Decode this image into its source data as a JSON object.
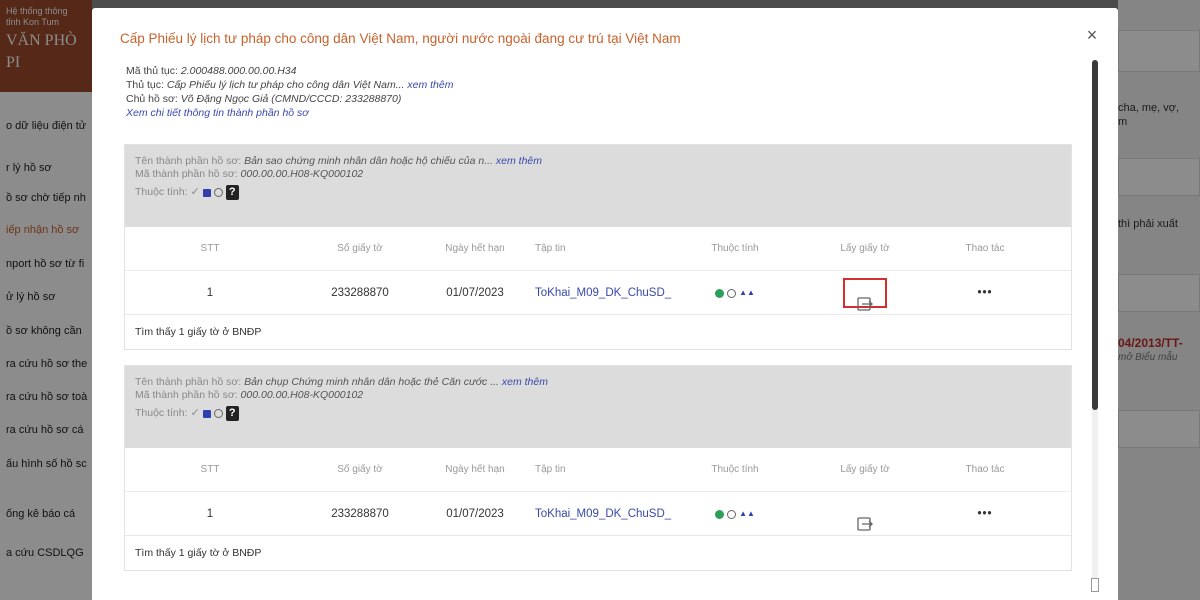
{
  "background": {
    "sidebar": {
      "brand_line1": "Hệ thống thông",
      "brand_line2": "tỉnh Kon Tum",
      "brand_line3": "VĂN PHÒ",
      "brand_line4": "PI",
      "items": [
        {
          "label": "o dữ liệu điện tử",
          "active": false
        },
        {
          "label": "r lý hồ sơ",
          "active": false
        },
        {
          "label": "ồ sơ chờ tiếp nh",
          "active": false
        },
        {
          "label": "iếp nhận hồ sơ",
          "active": true
        },
        {
          "label": "nport hồ sơ từ fi",
          "active": false
        },
        {
          "label": "ử lý hồ sơ",
          "active": false
        },
        {
          "label": "ồ sơ không cần",
          "active": false
        },
        {
          "label": "ra cứu hồ sơ the",
          "active": false
        },
        {
          "label": "ra cứu hồ sơ toà",
          "active": false
        },
        {
          "label": "ra cứu hồ sơ cá",
          "active": false
        },
        {
          "label": "ấu hình số hồ sc",
          "active": false
        },
        {
          "label": "ống kê báo cá",
          "active": false
        },
        {
          "label": "a cứu CSDLQG",
          "active": false
        }
      ]
    },
    "right": {
      "text1": "cha, mẹ, vợ,",
      "text2": "m",
      "text3": "thì phải xuất",
      "red_text": "04/2013/TT-",
      "italic_text": "mở Biểu mẫu"
    }
  },
  "modal": {
    "title": "Cấp Phiếu lý lịch tư pháp cho công dân Việt Nam, người nước ngoài đang cư trú tại Việt Nam",
    "close_symbol": "×",
    "info": {
      "ma_thu_tuc_label": "Mã thủ tục:",
      "ma_thu_tuc_value": "2.000488.000.00.00.H34",
      "thu_tuc_label": "Thủ tục:",
      "thu_tuc_value": "Cấp Phiếu lý lịch tư pháp cho công dân Việt Nam...",
      "xem_them": "xem thêm",
      "chu_ho_so_label": "Chủ hồ sơ:",
      "chu_ho_so_value": "Võ Đặng Ngọc Giả (CMND/CCCD: 233288870)",
      "detail_link": "Xem chi tiết thông tin thành phần hồ sơ"
    },
    "columns": {
      "stt": "STT",
      "so_giay_to": "Số giấy tờ",
      "ngay_het_han": "Ngày hết hạn",
      "tap_tin": "Tập tin",
      "thuoc_tinh": "Thuộc tính",
      "lay_giay_to": "Lấy giấy tờ",
      "thao_tac": "Thao tác"
    },
    "components": [
      {
        "ten_label": "Tên thành phần hồ sơ:",
        "ten_value": "Bản sao chứng minh nhân dân hoặc hộ chiếu của n...",
        "xem_them": "xem thêm",
        "ma_label": "Mã thành phần hồ sơ:",
        "ma_value": "000.00.00.H08-KQ000102",
        "thuoc_tinh_label": "Thuộc tính:",
        "row": {
          "stt": "1",
          "so_giay_to": "233288870",
          "ngay_het_han": "01/07/2023",
          "tap_tin": "ToKhai_M09_DK_ChuSD_",
          "actions": "•••"
        },
        "found_text": "Tìm thấy 1 giấy tờ ở BNĐP",
        "highlighted": true
      },
      {
        "ten_label": "Tên thành phần hồ sơ:",
        "ten_value": "Bản chụp Chứng minh nhân dân hoặc thẻ Căn cước ...",
        "xem_them": "xem thêm",
        "ma_label": "Mã thành phần hồ sơ:",
        "ma_value": "000.00.00.H08-KQ000102",
        "thuoc_tinh_label": "Thuộc tính:",
        "row": {
          "stt": "1",
          "so_giay_to": "233288870",
          "ngay_het_han": "01/07/2023",
          "tap_tin": "ToKhai_M09_DK_ChuSD_",
          "actions": "•••"
        },
        "found_text": "Tìm thấy 1 giấy tờ ở BNĐP",
        "highlighted": false
      }
    ]
  }
}
